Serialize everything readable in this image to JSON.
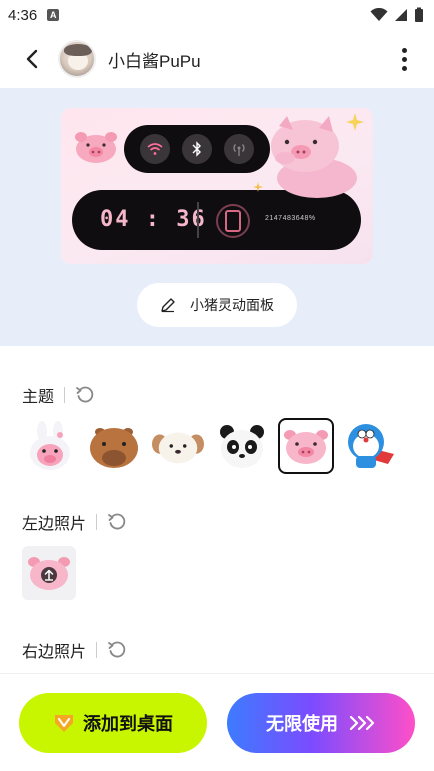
{
  "status_bar": {
    "time": "4:36",
    "notification_letter": "A"
  },
  "header": {
    "title": "小白酱PuPu"
  },
  "preview": {
    "clock": "04 : 36",
    "tiny_numbers": "2147483648%"
  },
  "name_chip": {
    "label": "小猪灵动面板"
  },
  "sections": {
    "theme_label": "主题",
    "left_photo_label": "左边照片",
    "right_photo_label": "右边照片"
  },
  "themes": [
    {
      "name": "pig-bunny"
    },
    {
      "name": "capybara"
    },
    {
      "name": "puppy"
    },
    {
      "name": "panda"
    },
    {
      "name": "pig",
      "selected": true
    },
    {
      "name": "doraemon"
    }
  ],
  "bottom": {
    "add_label": "添加到桌面",
    "vip_label": "无限使用"
  },
  "colors": {
    "accent_green": "#c8f500",
    "preview_bg": "#e8eef9",
    "pill_bg": "#0f0d10",
    "clock_pink": "#f4b6c9"
  }
}
